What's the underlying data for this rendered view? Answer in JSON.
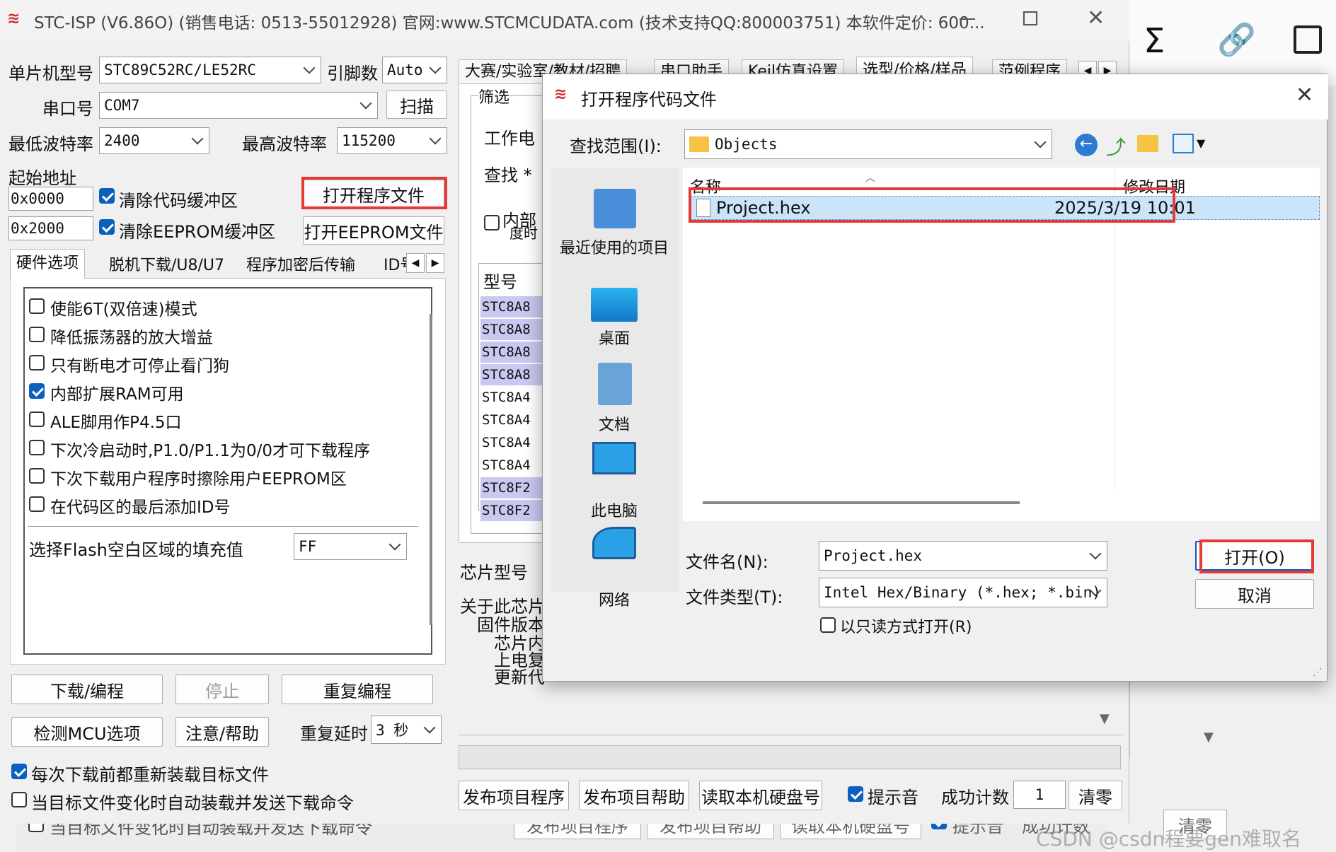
{
  "main_window": {
    "title": "STC-ISP (V6.86O) (销售电话: 0513-55012928) 官网:www.STCMCUDATA.com  (技术支持QQ:800003751) 本软件定价: 600...",
    "mcu_type_label": "单片机型号",
    "mcu_type_value": "STC89C52RC/LE52RC",
    "pins_label": "引脚数",
    "pins_value": "Auto",
    "port_label": "串口号",
    "port_value": "COM7",
    "scan_button": "扫描",
    "min_baud_label": "最低波特率",
    "min_baud_value": "2400",
    "max_baud_label": "最高波特率",
    "max_baud_value": "115200",
    "start_address_label": "起始地址",
    "addr1_value": "0x0000",
    "addr2_value": "0x2000",
    "clear_code_buffer": "清除代码缓冲区",
    "clear_eeprom_buffer": "清除EEPROM缓冲区",
    "open_program_button": "打开程序文件",
    "open_eeprom_button": "打开EEPROM文件",
    "tabs": [
      "硬件选项",
      "脱机下载/U8/U7",
      "程序加密后传输",
      "ID号"
    ],
    "hw_options": [
      {
        "label": "使能6T(双倍速)模式",
        "checked": false
      },
      {
        "label": "降低振荡器的放大增益",
        "checked": false
      },
      {
        "label": "只有断电才可停止看门狗",
        "checked": false
      },
      {
        "label": "内部扩展RAM可用",
        "checked": true
      },
      {
        "label": "ALE脚用作P4.5口",
        "checked": false
      },
      {
        "label": "下次冷启动时,P1.0/P1.1为0/0才可下载程序",
        "checked": false
      },
      {
        "label": "下次下载用户程序时擦除用户EEPROM区",
        "checked": false
      },
      {
        "label": "在代码区的最后添加ID号",
        "checked": false
      }
    ],
    "flash_fill_label": "选择Flash空白区域的填充值",
    "flash_fill_value": "FF",
    "download_button": "下载/编程",
    "stop_button": "停止",
    "reprogram_button": "重复编程",
    "detect_mcu_button": "检测MCU选项",
    "help_button": "注意/帮助",
    "repeat_delay_label": "重复延时",
    "repeat_delay_value": "3 秒",
    "reload_before_download": "每次下载前都重新装载目标文件",
    "auto_reload_on_change": "当目标文件变化时自动装载并发送下载命令",
    "right_tabs": [
      "大赛/实验室/教材/招聘",
      "串口助手",
      "Keil仿真设置",
      "选型/价格/样品",
      "范例程序"
    ],
    "filter_label": "筛选",
    "work_label": "工作电",
    "find_label": "查找 *",
    "internal_label": "内部",
    "degree_label": "度时",
    "model_header": "型号",
    "models": [
      "STC8A8",
      "STC8A8",
      "STC8A8",
      "STC8A8",
      "STC8A4",
      "STC8A4",
      "STC8A4",
      "STC8A4",
      "STC8F2",
      "STC8F2"
    ],
    "chip_model_label": "芯片型号",
    "about_chip_label": "关于此芯片",
    "firmware_label": "固件版本",
    "chip_internal_label": "芯片内",
    "power_on_label": "上电复",
    "update_label": "更新代",
    "publish_program_button": "发布项目程序",
    "publish_help_button": "发布项目帮助",
    "read_disk_button": "读取本机硬盘号",
    "beep_label": "提示音",
    "success_count_label": "成功计数",
    "success_count_value": "1",
    "clear_count_button": "清零"
  },
  "back_window": {
    "auto_reload_text": "当目标文件变化时自动装载并发送下载命令",
    "publish_program_button": "发布项目程序",
    "publish_help_button": "发布项目帮助",
    "read_disk_button": "读取本机硬盘号",
    "beep_label": "提示音",
    "success_count_label": "成功计数",
    "clear_button": "清零",
    "watermark": "CSDN @csdn程要gen难取名"
  },
  "dialog": {
    "title": "打开程序代码文件",
    "look_in_label": "查找范围(I):",
    "look_in_value": "Objects",
    "col_name": "名称",
    "col_modified": "修改日期",
    "files": [
      {
        "name": "Project.hex",
        "modified": "2025/3/19 10:01"
      }
    ],
    "sidebar": [
      "最近使用的项目",
      "桌面",
      "文档",
      "此电脑",
      "网络"
    ],
    "filename_label": "文件名(N):",
    "filename_value": "Project.hex",
    "filetype_label": "文件类型(T):",
    "filetype_value": "Intel Hex/Binary (*.hex; *.bin)",
    "readonly_label": "以只读方式打开(R)",
    "open_button": "打开(O)",
    "cancel_button": "取消"
  },
  "colors": {
    "highlight_red": "#e53935",
    "checkbox_blue": "#0a5fbf",
    "selection_blue": "#cce4f7",
    "model_highlight": "#c8c8f0"
  }
}
